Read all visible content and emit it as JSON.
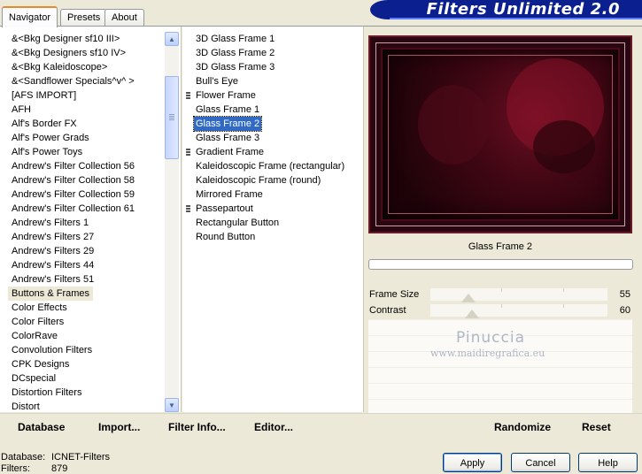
{
  "tabs": [
    {
      "label": "Navigator",
      "active": true
    },
    {
      "label": "Presets",
      "active": false
    },
    {
      "label": "About",
      "active": false
    }
  ],
  "title": "Filters Unlimited 2.0",
  "categories": [
    "&<Bkg Designer sf10 III>",
    "&<Bkg Designers sf10 IV>",
    "&<Bkg Kaleidoscope>",
    "&<Sandflower Specials^v^ >",
    "[AFS IMPORT]",
    "AFH",
    "Alf's Border FX",
    "Alf's Power Grads",
    "Alf's Power Toys",
    "Andrew's Filter Collection 56",
    "Andrew's Filter Collection 58",
    "Andrew's Filter Collection 59",
    "Andrew's Filter Collection 61",
    "Andrew's Filters 1",
    "Andrew's Filters 27",
    "Andrew's Filters 29",
    "Andrew's Filters 44",
    "Andrew's Filters 51",
    "Buttons & Frames",
    "Color Effects",
    "Color Filters",
    "ColorRave",
    "Convolution Filters",
    "CPK Designs",
    "DCspecial",
    "Distortion Filters",
    "Distort"
  ],
  "selected_category": "Buttons & Frames",
  "filters": [
    {
      "label": "3D Glass Frame 1",
      "group": false
    },
    {
      "label": "3D Glass Frame 2",
      "group": false
    },
    {
      "label": "3D Glass Frame 3",
      "group": false
    },
    {
      "label": "Bull's Eye",
      "group": false
    },
    {
      "label": "Flower Frame",
      "group": true
    },
    {
      "label": "Glass Frame 1",
      "group": false
    },
    {
      "label": "Glass Frame 2",
      "group": false
    },
    {
      "label": "Glass Frame 3",
      "group": false
    },
    {
      "label": "Gradient Frame",
      "group": true
    },
    {
      "label": "Kaleidoscopic Frame (rectangular)",
      "group": false
    },
    {
      "label": "Kaleidoscopic Frame (round)",
      "group": false
    },
    {
      "label": "Mirrored Frame",
      "group": false
    },
    {
      "label": "Passepartout",
      "group": true
    },
    {
      "label": "Rectangular Button",
      "group": false
    },
    {
      "label": "Round Button",
      "group": false
    }
  ],
  "selected_filter": "Glass Frame 2",
  "preview_filter_name": "Glass Frame 2",
  "params": [
    {
      "label": "Frame Size",
      "value": "55",
      "level": 55
    },
    {
      "label": "Contrast",
      "value": "60",
      "level": 60
    }
  ],
  "watermark": {
    "name": "Pinuccia",
    "url": "www.maidiregrafica.eu"
  },
  "toolbar": {
    "database": "Database",
    "import": "Import...",
    "filter_info": "Filter Info...",
    "editor": "Editor...",
    "randomize": "Randomize",
    "reset": "Reset"
  },
  "status": {
    "database_label": "Database:",
    "database_value": "ICNET-Filters",
    "filters_label": "Filters:",
    "filters_value": "879"
  },
  "buttons": {
    "apply": "Apply",
    "cancel": "Cancel",
    "help": "Help"
  },
  "colors": {
    "selection": "#316ac5",
    "banner": "#0b1f8f",
    "preview_bg": "#2a0710"
  }
}
